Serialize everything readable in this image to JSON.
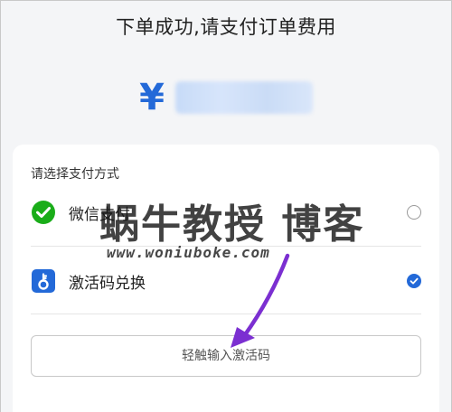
{
  "header": {
    "title": "下单成功,请支付订单费用",
    "currency_symbol": "¥"
  },
  "payment": {
    "section_label": "请选择支付方式",
    "methods": [
      {
        "label": "微信支付",
        "icon": "wechat-icon",
        "selected": false
      },
      {
        "label": "激活码兑换",
        "icon": "key-icon",
        "selected": true
      }
    ],
    "code_input_placeholder": "轻触输入激活码"
  },
  "watermark": {
    "name": "蜗牛教授 博客",
    "url": "www.woniubokе.com"
  },
  "colors": {
    "accent": "#2369d8",
    "wechat_green": "#1aad19",
    "arrow": "#7b2fd1"
  }
}
